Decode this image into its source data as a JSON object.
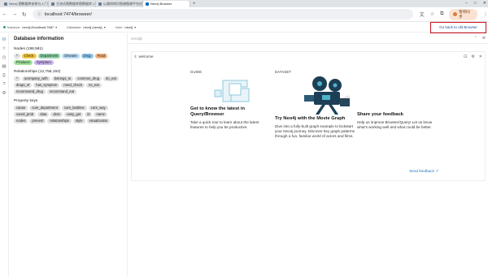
{
  "browser": {
    "tabs": [
      {
        "label": "Neo4j 图数据库安装与入门教程 (…",
        "active": false
      },
      {
        "label": "主流式图数据库图数据库 | Neo4…",
        "active": false
      },
      {
        "label": "以政府知识图谱图谱平台应用 (…",
        "active": false
      },
      {
        "label": "Neo4j Browser",
        "active": true
      }
    ],
    "new_tab": "+",
    "window_controls": [
      "–",
      "□",
      "✕"
    ],
    "url": "localhost:7474/browser/",
    "profile_label": "暂停同步"
  },
  "app_header": {
    "instance_label": "Instance:",
    "instance_value": "neo4j://localhost:7687",
    "database_label": "Database:",
    "database_value": "neo4j (neo4j)",
    "user_label": "User:",
    "user_value": "neo4j",
    "old_browser_label": "Go back to old Browser"
  },
  "sidebar": {
    "title": "Database information",
    "nodes_header": "Nodes (198,581)",
    "node_labels": [
      {
        "label": "*",
        "color": "#e0e0e0"
      },
      {
        "label": "Check",
        "color": "#f4c542"
      },
      {
        "label": "Department",
        "color": "#8fd3a6"
      },
      {
        "label": "Disease",
        "color": "#b6d8f5"
      },
      {
        "label": "Drug",
        "color": "#8fc7f0"
      },
      {
        "label": "Food",
        "color": "#f2b27a"
      },
      {
        "label": "Producer",
        "color": "#9ee39b"
      },
      {
        "label": "Symptom",
        "color": "#c9b3f0"
      }
    ],
    "rels_header": "Relationships (12,756,192)",
    "rel_types": [
      "*",
      "acompany_with",
      "belongs_to",
      "common_drug",
      "do_eat",
      "drugs_of",
      "has_symptom",
      "need_check",
      "no_eat",
      "recommand_drug",
      "recommand_eat"
    ],
    "props_header": "Property keys",
    "prop_keys": [
      "cause",
      "cure_department",
      "cure_lasttime",
      "cure_way",
      "cured_prob",
      "data",
      "desc",
      "easy_get",
      "id",
      "name",
      "nodes",
      "prevent",
      "relationships",
      "style",
      "visualization"
    ]
  },
  "editor": {
    "placeholder": "neo4j$"
  },
  "welcome_frame": {
    "command": ":welcome",
    "cards": [
      {
        "tag": "GUIDE",
        "title": "Get to know the latest in Query/Browser",
        "desc": "Take a quick tour to learn about the latest features to help you be productive."
      },
      {
        "tag": "DATASET",
        "title": "Try Neo4j with the Movie Graph",
        "desc": "Dive into a fully-built graph example to kickstart your Neo4j journey. Discover key graph patterns through a fun, familiar world of actors and films."
      },
      {
        "tag": "",
        "title": "Share your feedback",
        "desc": "Help us improve Browser/Query! Let us know what's working well and what could be better.",
        "link": "Send feedback ↗"
      }
    ]
  }
}
